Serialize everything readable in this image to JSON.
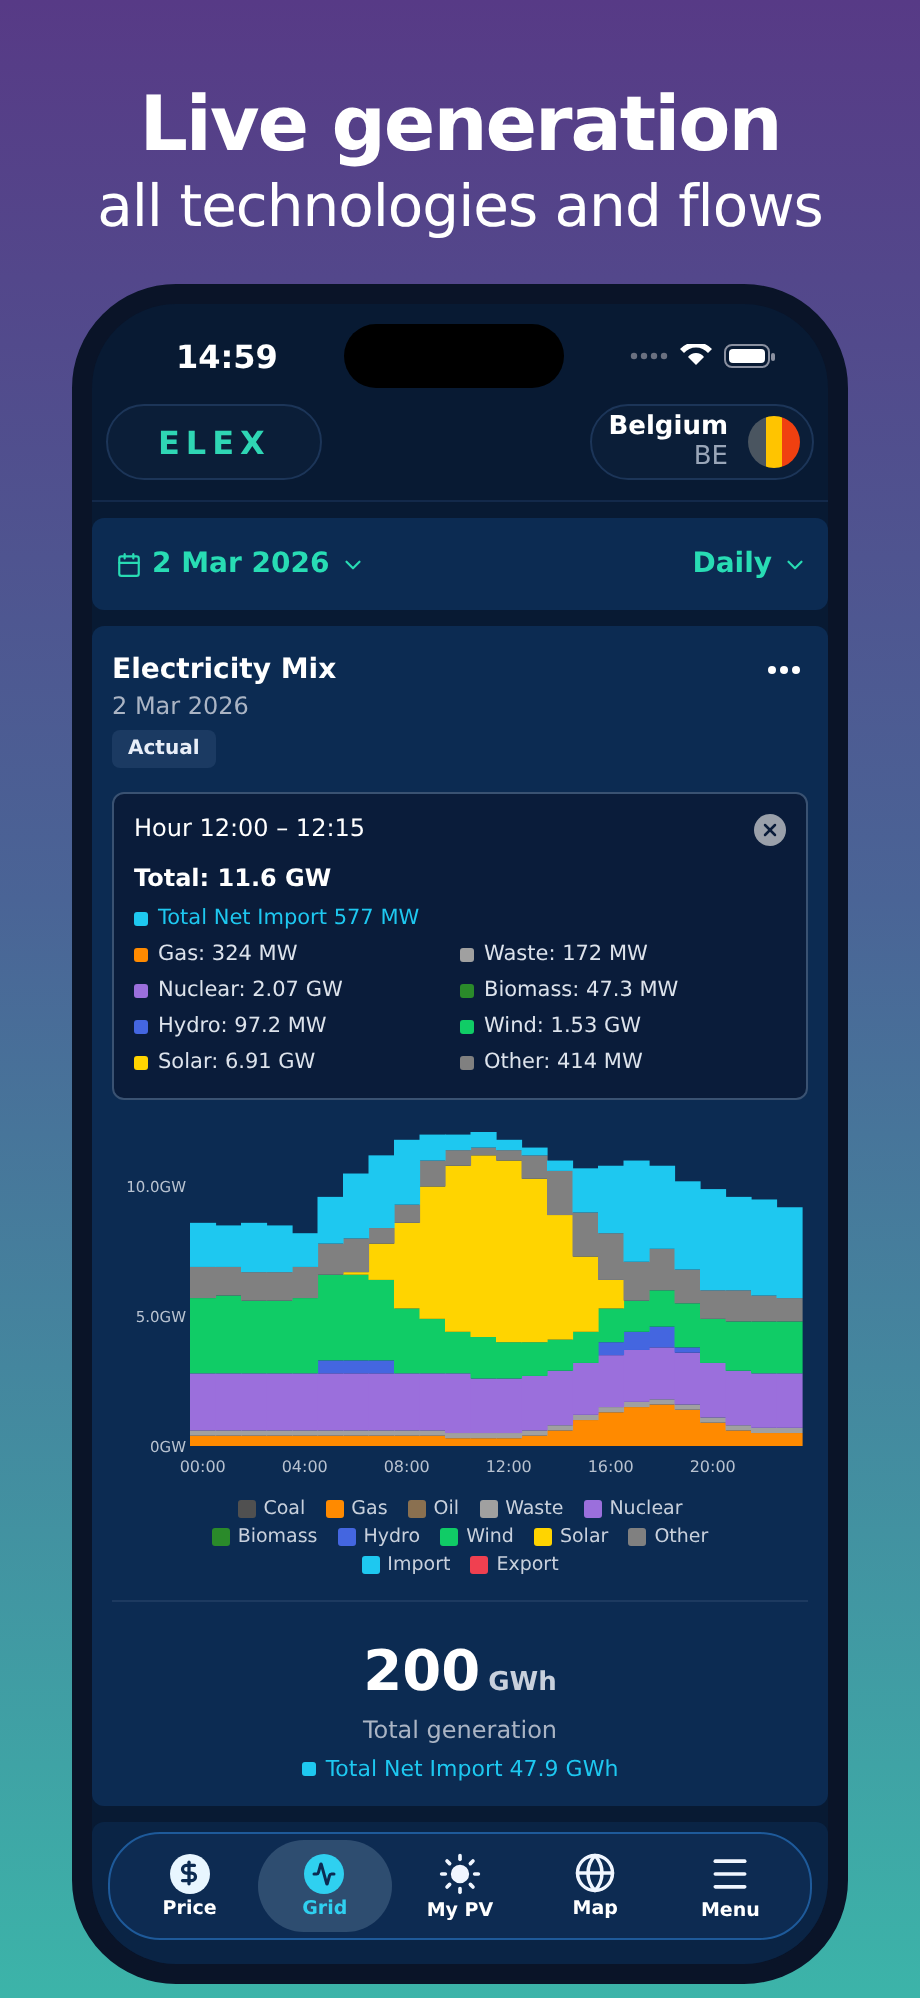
{
  "headline": {
    "title": "Live generation",
    "subtitle": "all technologies and flows"
  },
  "status_bar": {
    "time": "14:59"
  },
  "header": {
    "logo": "ELEX",
    "country": {
      "name": "Belgium",
      "code": "BE"
    }
  },
  "date_bar": {
    "date": "2 Mar 2026",
    "period": "Daily"
  },
  "card": {
    "title": "Electricity Mix",
    "date": "2 Mar 2026",
    "badge": "Actual",
    "tooltip": {
      "title": "Hour 12:00 – 12:15",
      "total": "Total: 11.6 GW",
      "import": {
        "text": "Total Net Import 577 MW",
        "color": "#1ec8f0"
      },
      "items": [
        {
          "text": "Gas: 324 MW",
          "color": "#ff8a00"
        },
        {
          "text": "Waste: 172 MW",
          "color": "#a0a0a0"
        },
        {
          "text": "Nuclear: 2.07 GW",
          "color": "#9b6fdc"
        },
        {
          "text": "Biomass: 47.3 MW",
          "color": "#2a8a2a"
        },
        {
          "text": "Hydro: 97.2 MW",
          "color": "#4466e0"
        },
        {
          "text": "Wind: 1.53 GW",
          "color": "#10cc66"
        },
        {
          "text": "Solar: 6.91 GW",
          "color": "#ffd400"
        },
        {
          "text": "Other: 414 MW",
          "color": "#808080"
        }
      ]
    },
    "chart_data": {
      "type": "bar",
      "stacked": true,
      "x": [
        0,
        1,
        2,
        3,
        4,
        5,
        6,
        7,
        8,
        9,
        10,
        11,
        12,
        13,
        14,
        15,
        16,
        17,
        18,
        19,
        20,
        21,
        22,
        23
      ],
      "series": [
        {
          "name": "Coal",
          "color": "#505050",
          "values": [
            0,
            0,
            0,
            0,
            0,
            0,
            0,
            0,
            0,
            0,
            0,
            0,
            0,
            0,
            0,
            0,
            0,
            0,
            0,
            0,
            0,
            0,
            0,
            0
          ]
        },
        {
          "name": "Gas",
          "color": "#ff8a00",
          "values": [
            0.4,
            0.4,
            0.4,
            0.4,
            0.4,
            0.4,
            0.4,
            0.4,
            0.4,
            0.4,
            0.3,
            0.3,
            0.3,
            0.4,
            0.6,
            1.0,
            1.3,
            1.5,
            1.6,
            1.4,
            0.9,
            0.6,
            0.5,
            0.5
          ]
        },
        {
          "name": "Oil",
          "color": "#8a7050",
          "values": [
            0,
            0,
            0,
            0,
            0,
            0,
            0,
            0,
            0,
            0,
            0,
            0,
            0,
            0,
            0,
            0,
            0,
            0,
            0,
            0,
            0,
            0,
            0,
            0
          ]
        },
        {
          "name": "Waste",
          "color": "#a0a0a0",
          "values": [
            0.2,
            0.2,
            0.2,
            0.2,
            0.2,
            0.2,
            0.2,
            0.2,
            0.2,
            0.2,
            0.2,
            0.2,
            0.2,
            0.2,
            0.2,
            0.2,
            0.2,
            0.2,
            0.2,
            0.2,
            0.2,
            0.2,
            0.2,
            0.2
          ]
        },
        {
          "name": "Nuclear",
          "color": "#9b6fdc",
          "values": [
            2.2,
            2.2,
            2.2,
            2.2,
            2.2,
            2.2,
            2.2,
            2.2,
            2.2,
            2.2,
            2.3,
            2.1,
            2.1,
            2.1,
            2.1,
            2.0,
            2.0,
            2.0,
            2.0,
            2.0,
            2.1,
            2.1,
            2.1,
            2.1
          ]
        },
        {
          "name": "Biomass",
          "color": "#2a8a2a",
          "values": [
            0,
            0,
            0,
            0,
            0,
            0,
            0,
            0,
            0,
            0,
            0,
            0,
            0,
            0,
            0,
            0,
            0,
            0,
            0,
            0,
            0,
            0,
            0,
            0
          ]
        },
        {
          "name": "Hydro",
          "color": "#4466e0",
          "values": [
            0,
            0,
            0,
            0,
            0,
            0.5,
            0.5,
            0.5,
            0,
            0,
            0,
            0,
            0,
            0,
            0,
            0,
            0.5,
            0.7,
            0.8,
            0.2,
            0,
            0,
            0,
            0
          ]
        },
        {
          "name": "Wind",
          "color": "#10cc66",
          "values": [
            2.9,
            3.0,
            2.8,
            2.8,
            2.9,
            3.3,
            3.3,
            3.1,
            2.5,
            2.1,
            1.6,
            1.6,
            1.4,
            1.3,
            1.2,
            1.2,
            1.3,
            1.2,
            1.4,
            1.7,
            1.7,
            1.9,
            2.0,
            2.0
          ]
        },
        {
          "name": "Solar",
          "color": "#ffd400",
          "values": [
            0,
            0,
            0,
            0,
            0,
            0,
            0.1,
            1.4,
            3.3,
            5.1,
            6.4,
            7.0,
            7.0,
            6.3,
            4.8,
            2.9,
            1.1,
            0,
            0,
            0,
            0,
            0,
            0,
            0
          ]
        },
        {
          "name": "Other",
          "color": "#808080",
          "values": [
            1.2,
            1.1,
            1.1,
            1.1,
            1.2,
            1.2,
            1.3,
            0.6,
            0.7,
            1.0,
            0.6,
            0.3,
            0.4,
            0.9,
            1.7,
            1.7,
            1.8,
            1.5,
            1.6,
            1.3,
            1.1,
            1.2,
            1.0,
            0.9
          ]
        },
        {
          "name": "Import",
          "color": "#1ec8f0",
          "values": [
            1.7,
            1.6,
            1.9,
            1.8,
            1.3,
            1.8,
            2.5,
            2.8,
            2.5,
            1.0,
            0.6,
            0.6,
            0.4,
            0.3,
            0.4,
            1.7,
            2.6,
            3.9,
            3.2,
            3.4,
            3.9,
            3.6,
            3.7,
            3.5
          ]
        },
        {
          "name": "Export",
          "color": "#f04050",
          "values": [
            0,
            0,
            0,
            0,
            0,
            0,
            0,
            0,
            0,
            0,
            0,
            0,
            0,
            0,
            0,
            0,
            0,
            0,
            0,
            0,
            0,
            0,
            0,
            0
          ]
        }
      ],
      "xlim": [
        -0.5,
        23.5
      ],
      "ylim": [
        0,
        12.1
      ],
      "yticks": [
        {
          "value": 0,
          "label": "0GW"
        },
        {
          "value": 5,
          "label": "5.0GW"
        },
        {
          "value": 10,
          "label": "10.0GW"
        }
      ],
      "xticks": [
        {
          "value": 0,
          "label": "00:00"
        },
        {
          "value": 4,
          "label": "04:00"
        },
        {
          "value": 8,
          "label": "08:00"
        },
        {
          "value": 12,
          "label": "12:00"
        },
        {
          "value": 16,
          "label": "16:00"
        },
        {
          "value": 20,
          "label": "20:00"
        }
      ]
    },
    "summary": {
      "value": "200",
      "unit": "GWh",
      "label": "Total generation",
      "import": {
        "text": "Total Net Import 47.9 GWh",
        "color": "#1ec8f0"
      }
    }
  },
  "nav": [
    {
      "label": "Price",
      "selected": false
    },
    {
      "label": "Grid",
      "selected": true
    },
    {
      "label": "My PV",
      "selected": false
    },
    {
      "label": "Map",
      "selected": false
    },
    {
      "label": "Menu",
      "selected": false
    }
  ]
}
